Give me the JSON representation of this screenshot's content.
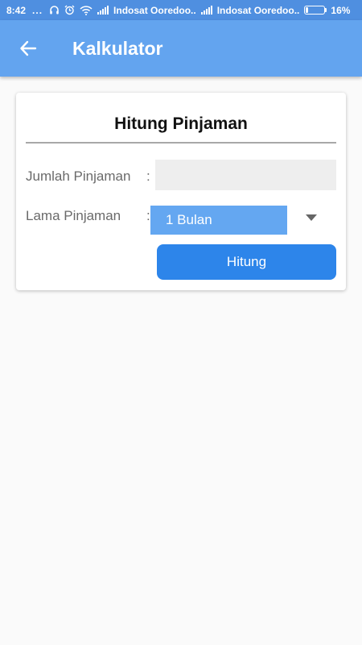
{
  "status_bar": {
    "time": "8:42",
    "dots": "...",
    "carrier_1": "Indosat Ooredoo..",
    "carrier_2": "Indosat Ooredoo..",
    "battery_percent": "16%",
    "battery_level": 0.16,
    "icons": [
      "headset-icon",
      "alarm-icon",
      "wifi-icon",
      "signal-icon",
      "signal-icon",
      "battery-icon"
    ]
  },
  "app_bar": {
    "back_icon": "arrow-back-icon",
    "title": "Kalkulator",
    "color": "#63a4ef"
  },
  "form": {
    "title": "Hitung Pinjaman",
    "amount_label": "Jumlah Pinjaman",
    "amount_value": "",
    "duration_label": "Lama Pinjaman",
    "colon": ":",
    "duration_selected": "1 Bulan",
    "dropdown_icon": "caret-down-icon",
    "submit_label": "Hitung",
    "submit_color": "#2d85ea"
  }
}
